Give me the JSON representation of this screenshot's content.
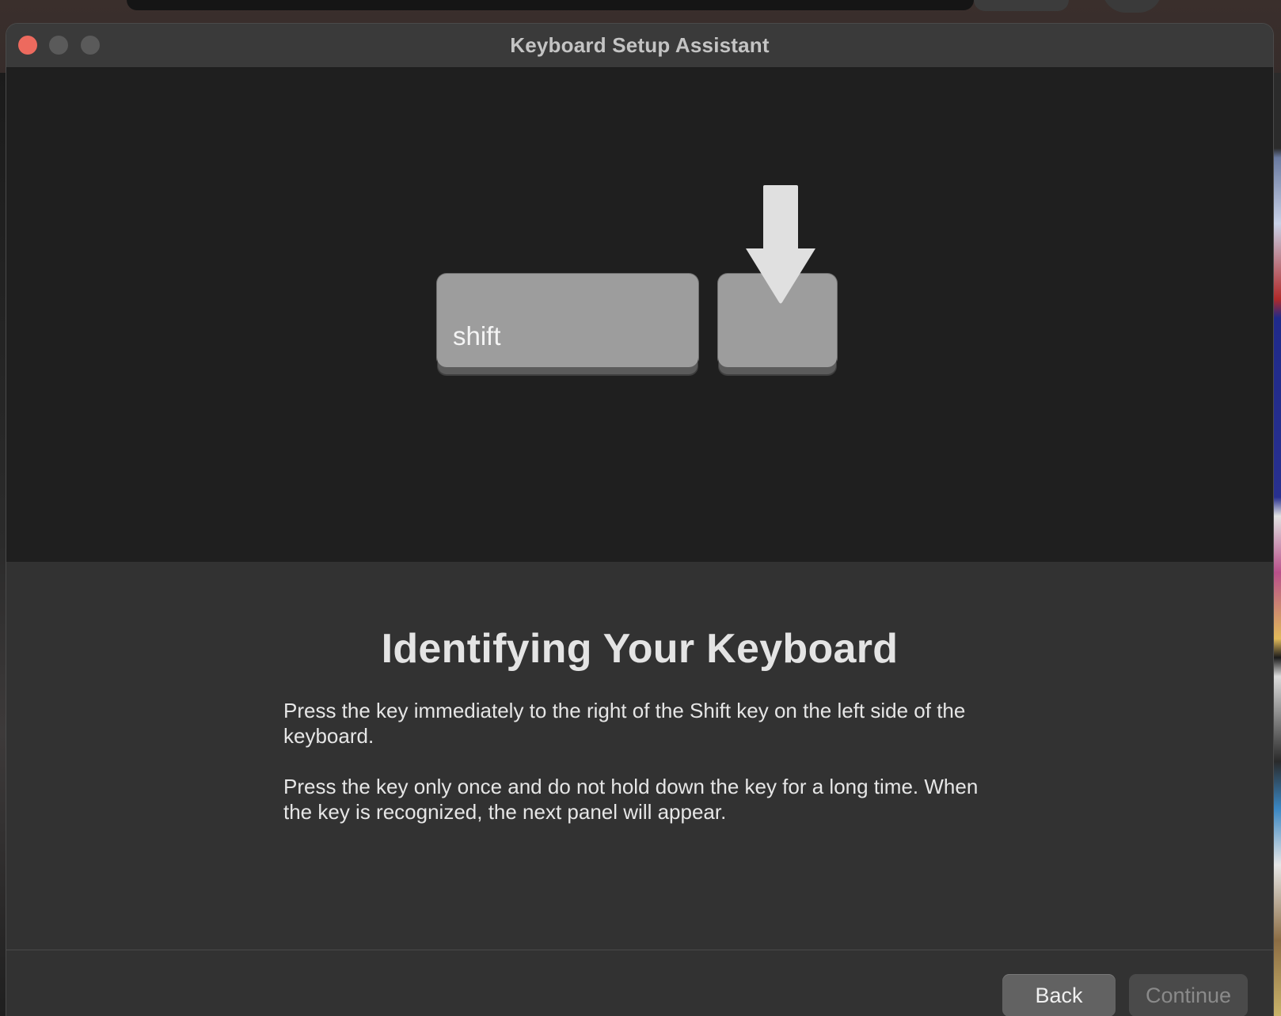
{
  "window": {
    "title": "Keyboard Setup Assistant"
  },
  "illustration": {
    "shift_key_label": "shift",
    "arrow_icon": "down-arrow-icon"
  },
  "content": {
    "heading": "Identifying Your Keyboard",
    "paragraph_1": "Press the key immediately to the right of the Shift key on the left side of the keyboard.",
    "paragraph_2": "Press the key only once and do not hold down the key for a long time. When the key is recognized, the next panel will appear."
  },
  "footer": {
    "back_label": "Back",
    "continue_label": "Continue"
  },
  "colors": {
    "close_button": "#ed6a5e",
    "window_background": "#323232",
    "illustration_background": "#1f1f1f",
    "key_color": "#9d9d9d"
  }
}
